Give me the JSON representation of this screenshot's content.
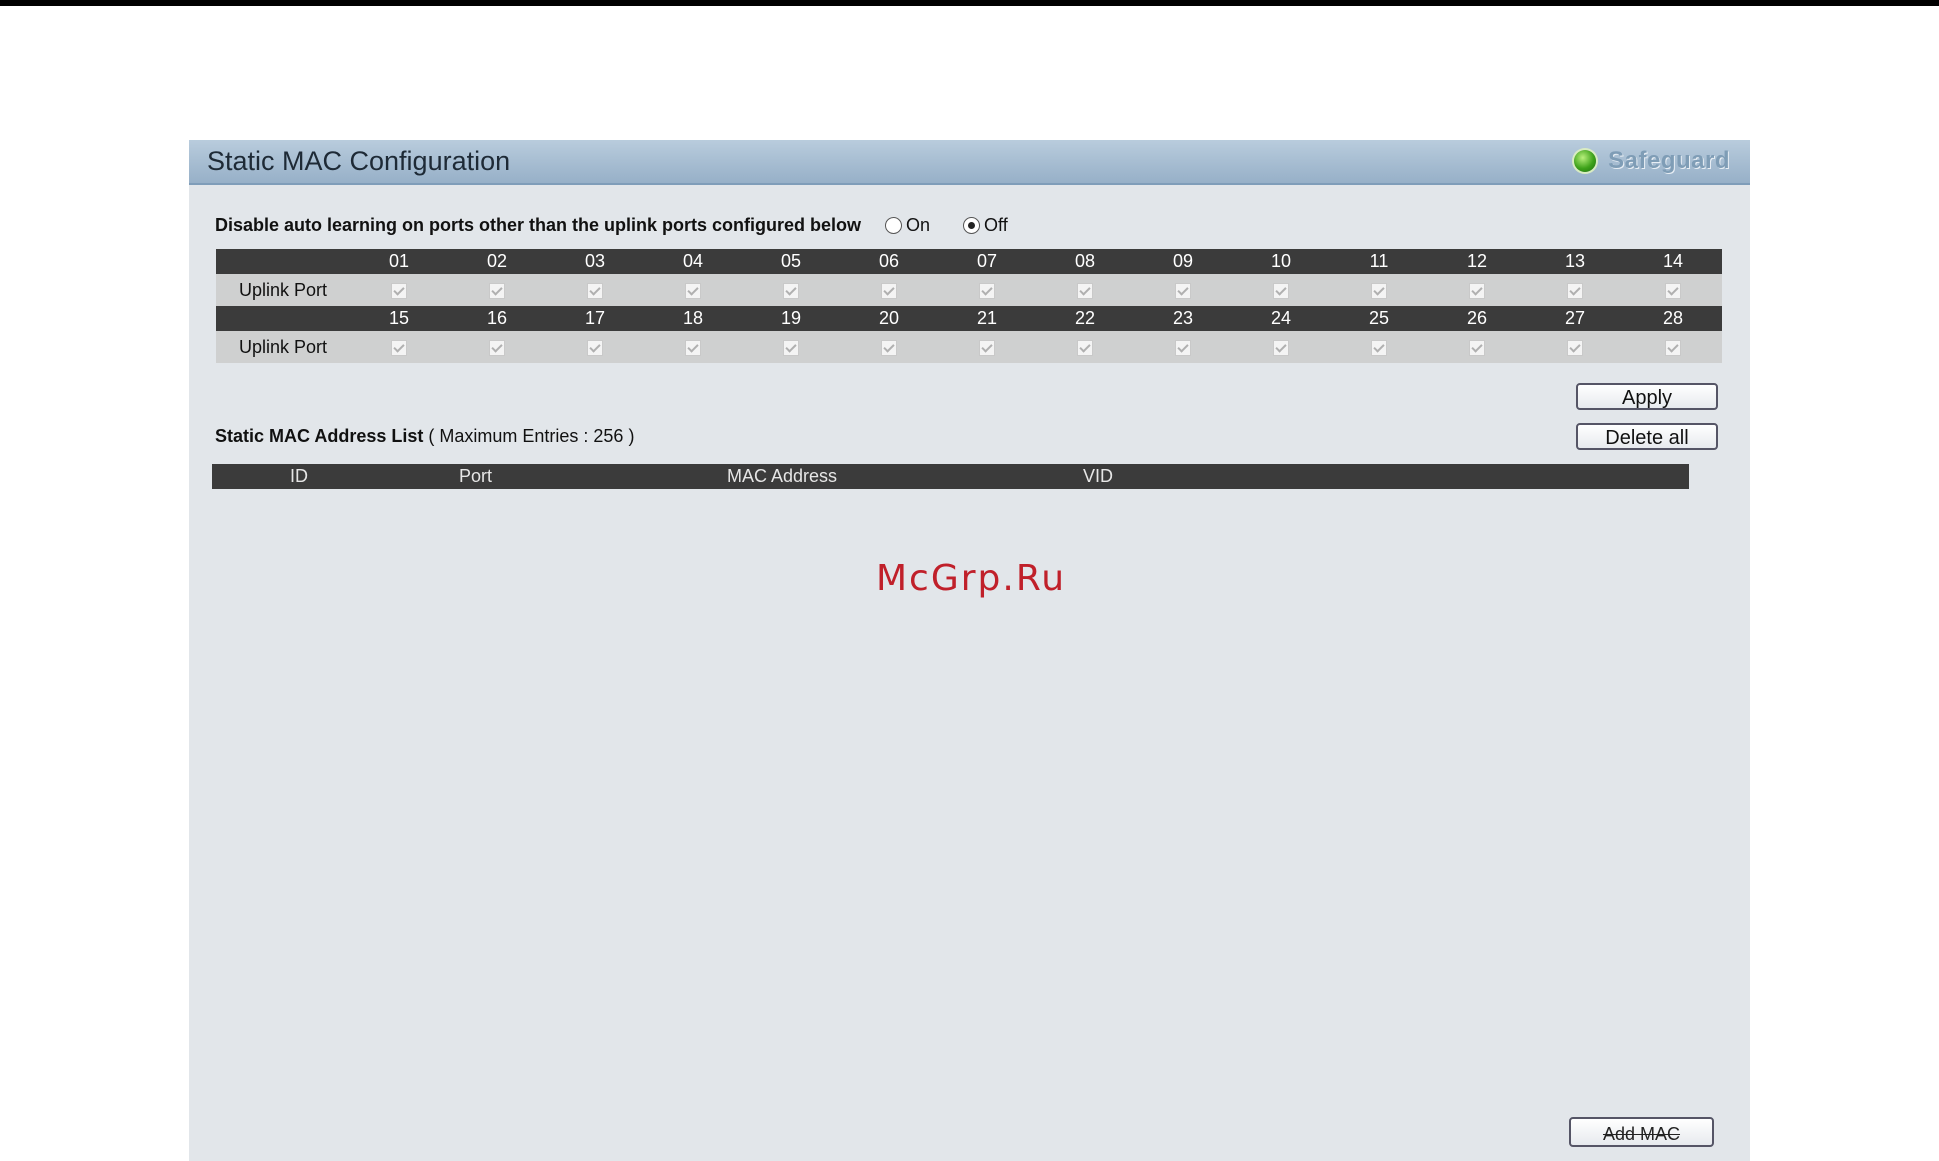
{
  "header": {
    "title": "Static MAC Configuration",
    "safeguard_label": "Safeguard"
  },
  "auto_learning": {
    "label": "Disable auto learning on ports other than the uplink ports configured below",
    "options": [
      {
        "label": "On",
        "selected": false
      },
      {
        "label": "Off",
        "selected": true
      }
    ]
  },
  "ports": {
    "row_label": "Uplink Port",
    "groups": [
      [
        "01",
        "02",
        "03",
        "04",
        "05",
        "06",
        "07",
        "08",
        "09",
        "10",
        "11",
        "12",
        "13",
        "14"
      ],
      [
        "15",
        "16",
        "17",
        "18",
        "19",
        "20",
        "21",
        "22",
        "23",
        "24",
        "25",
        "26",
        "27",
        "28"
      ]
    ],
    "all_checked": true
  },
  "buttons": {
    "apply": "Apply",
    "delete_all": "Delete all",
    "add_mac": "Add MAC"
  },
  "mac_list": {
    "title": "Static MAC Address List",
    "max_entries": "( Maximum Entries : 256 )",
    "columns": [
      "ID",
      "Port",
      "MAC Address",
      "VID"
    ],
    "rows": []
  },
  "watermark": "McGrp.Ru"
}
